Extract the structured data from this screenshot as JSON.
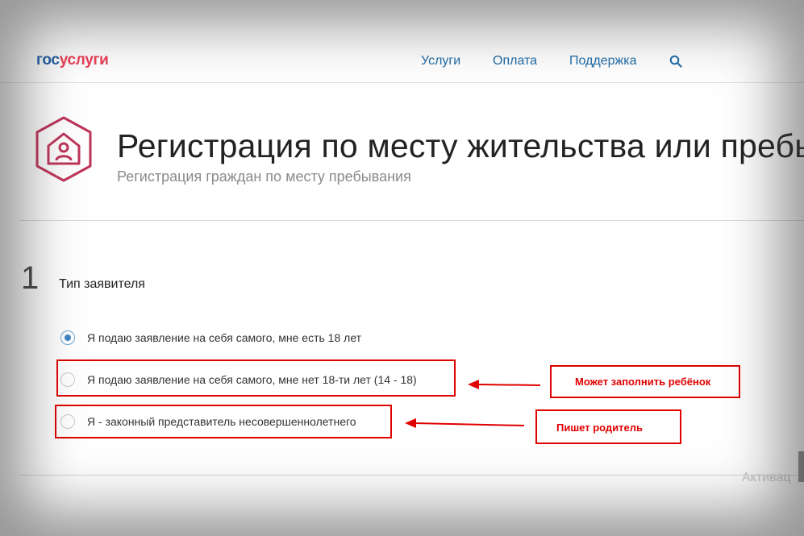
{
  "header": {
    "logo_part1": "гос",
    "logo_part2": "услуги",
    "nav": [
      "Услуги",
      "Оплата",
      "Поддержка"
    ],
    "search_icon": "search-icon"
  },
  "service": {
    "icon": "house-person-icon",
    "title": "Регистрация по месту жительства или пребы",
    "subtitle": "Регистрация граждан по месту пребывания"
  },
  "step": {
    "number": "1",
    "title": "Тип заявителя",
    "options": [
      {
        "label": "Я подаю заявление на себя самого, мне есть 18 лет",
        "selected": true
      },
      {
        "label": "Я подаю заявление на себя самого, мне нет 18-ти лет (14 - 18)",
        "selected": false
      },
      {
        "label": "Я - законный представитель несовершеннолетнего",
        "selected": false
      }
    ]
  },
  "annotations": [
    "Может заполнить ребёнок",
    "Пишет родитель"
  ],
  "footer_faded_text": "Активац",
  "colors": {
    "link": "#1f6ca8",
    "brand_red": "#ee3f58",
    "brand_blue": "#1f5fa8",
    "icon_crimson": "#c0345a",
    "annotation_red": "#e00000",
    "radio_blue": "#3f88c6"
  }
}
